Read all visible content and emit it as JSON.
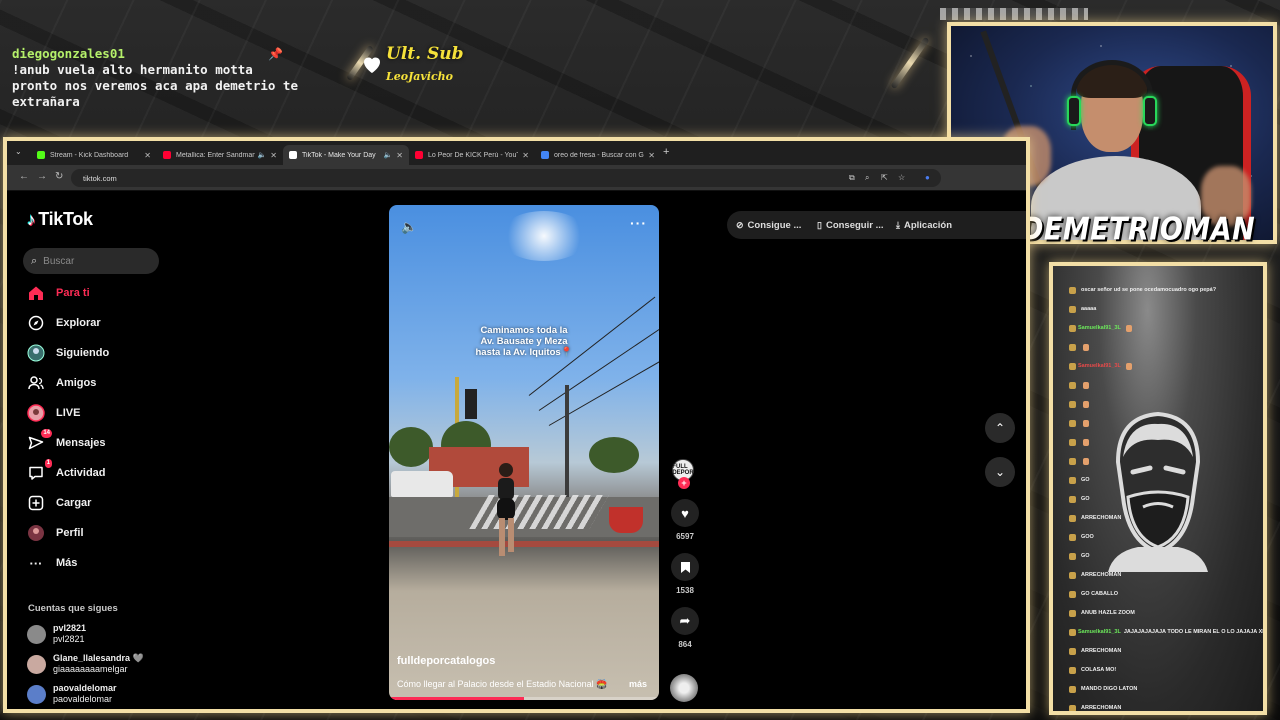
{
  "overlay": {
    "chat_user": "diegogonzales01",
    "chat_message": "!anub vuela alto hermanito motta\npronto nos veremos aca apa demetrio te\nextrañara",
    "last_sub_title": "Ult. Sub",
    "last_sub_name": "LeoJavicho",
    "streamer_name": "DEMETRIOMAN"
  },
  "browser": {
    "tabs": [
      {
        "label": "Stream - Kick Dashboard",
        "favicon_color": "#53fc18",
        "active": false
      },
      {
        "label": "Metallica: Enter Sandman (Offi...",
        "favicon_color": "#ff0033",
        "active": false
      },
      {
        "label": "TikTok - Make Your Day",
        "favicon_color": "#ffffff",
        "active": true
      },
      {
        "label": "Lo Peor De KICK Perú - YouTube",
        "favicon_color": "#ff0033",
        "active": false
      },
      {
        "label": "oreo de fresa - Buscar con Google",
        "favicon_color": "#4285f4",
        "active": false
      }
    ],
    "url": "tiktok.com"
  },
  "tiktok": {
    "brand": "TikTok",
    "search_placeholder": "Buscar",
    "nav": [
      {
        "label": "Para ti",
        "icon": "home-icon",
        "active": true
      },
      {
        "label": "Explorar",
        "icon": "compass-icon"
      },
      {
        "label": "Siguiendo",
        "icon": "following-avatar-icon"
      },
      {
        "label": "Amigos",
        "icon": "friends-icon"
      },
      {
        "label": "LIVE",
        "icon": "live-icon"
      },
      {
        "label": "Mensajes",
        "icon": "messages-icon",
        "badge": "14"
      },
      {
        "label": "Actividad",
        "icon": "activity-icon",
        "badge": "1"
      },
      {
        "label": "Cargar",
        "icon": "upload-icon"
      },
      {
        "label": "Perfil",
        "icon": "profile-icon"
      },
      {
        "label": "Más",
        "icon": "more-icon"
      }
    ],
    "following_title": "Cuentas que sigues",
    "following": [
      {
        "name": "pvl2821",
        "sub": "pvl2821"
      },
      {
        "name": "Glane_llalesandra 🩶",
        "sub": "giaaaaaaaamelgar"
      },
      {
        "name": "paovaldelomar",
        "sub": "paovaldelomar"
      }
    ],
    "top_actions": [
      {
        "label": "Consigue ...",
        "icon": "coin-icon"
      },
      {
        "label": "Conseguir ...",
        "icon": "phone-icon"
      },
      {
        "label": "Aplicación",
        "icon": "download-icon"
      }
    ],
    "video": {
      "caption": "Caminamos toda la\nAv. Bausate y Meza\nhasta la Av. Iquitos📍",
      "author": "fulldeporcatalogos",
      "description": "Cómo llegar al Palacio desde el Estadio Nacional 🏟️",
      "more": "más",
      "progress": 0.5,
      "creator_badge": "FULL DEPOR",
      "likes": "6597",
      "saves": "1538",
      "shares": "864"
    }
  },
  "stream_chat": [
    {
      "user": "",
      "text": "oscar señor ud se pone ocedamocuadro ogo pepá?"
    },
    {
      "user": "",
      "text": "aaaaa"
    },
    {
      "user": "SamueIkal91_3L",
      "text": ""
    },
    {
      "user": "",
      "text": ""
    },
    {
      "user": "SamueIkal91_3L",
      "text": ""
    },
    {
      "user": "",
      "text": ""
    },
    {
      "user": "",
      "text": ""
    },
    {
      "user": "",
      "text": ""
    },
    {
      "user": "",
      "text": ""
    },
    {
      "user": "",
      "text": ""
    },
    {
      "user": "",
      "text": "GO"
    },
    {
      "user": "",
      "text": "GO"
    },
    {
      "user": "",
      "text": "ARRECHOMAN"
    },
    {
      "user": "",
      "text": "GOO"
    },
    {
      "user": "",
      "text": "GO"
    },
    {
      "user": "",
      "text": "ARRECHOMAN"
    },
    {
      "user": "",
      "text": "GO CABALLO"
    },
    {
      "user": "",
      "text": "ANUB HAZLE ZOOM"
    },
    {
      "user": "SamueIkal91_3L",
      "text": "JAJAJAJAJAJA TODO LE MIRAN EL O LO JAJAJA XDDD"
    },
    {
      "user": "",
      "text": "ARRECHOMAN"
    },
    {
      "user": "",
      "text": "COLASA MO!"
    },
    {
      "user": "",
      "text": "MANDO DIGO LATON"
    },
    {
      "user": "",
      "text": "ARRECHOMAN"
    }
  ],
  "colors": {
    "tiktok_accent": "#fe2c55",
    "frame_glow": "#f3dfa6",
    "chat_user_green": "#b5f06a",
    "sub_yellow": "#f6e23a"
  }
}
